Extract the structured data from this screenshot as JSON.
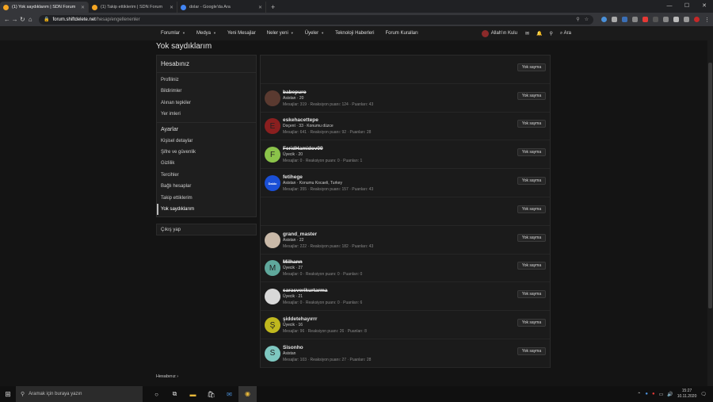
{
  "browser": {
    "tabs": [
      {
        "title": "(1) Yok saydıklarım | SDN Forum",
        "active": true,
        "icon_color": "#f5a623"
      },
      {
        "title": "(1) Takip ettiklerim | SDN Forum",
        "active": false,
        "icon_color": "#f5a623"
      },
      {
        "title": "dolar - Google'da Ara",
        "active": false,
        "icon_color": "#4285f4"
      }
    ],
    "url_host": "forum.shiftdelete.net",
    "url_path": "/hesap/engellenenler"
  },
  "sitenav": {
    "items": [
      "Forumlar",
      "Medya",
      "Yeni Mesajlar",
      "Neler yeni",
      "Üyeler",
      "Teknoloji Haberleri",
      "Forum Kuralları"
    ],
    "has_caret": [
      true,
      true,
      false,
      true,
      true,
      false,
      false
    ],
    "username": "Allah'ın Kulu",
    "search": "Ara"
  },
  "page": {
    "title": "Yok saydıklarım"
  },
  "sidebar": {
    "heading": "Hesabınız",
    "group1": [
      "Profiliniz",
      "Bildirimler",
      "Alınan tepkiler",
      "Yer imleri"
    ],
    "heading2": "Ayarlar",
    "group2": [
      "Kişisel detaylar",
      "Şifre ve güvenlik",
      "Gizlilik",
      "Tercihler",
      "Bağlı hesaplar",
      "Takip ettiklerim",
      "Yok saydıklarım"
    ],
    "logout": "Çıkış yap"
  },
  "ignore_label": "Yok sayma",
  "users": [
    {
      "name": "",
      "title": "",
      "stats": "",
      "avatar": "",
      "color": ""
    },
    {
      "name": "babepuro",
      "strike": true,
      "title": "Asistan · 20",
      "stats": "Mesajlar: 319 · Reaksiyon puanı: 124 · Puanları: 43",
      "avatar": "",
      "color": "#5a3a30"
    },
    {
      "name": "eskehacettepe",
      "strike": false,
      "title": "Doçent · 33 · Konumu düzce",
      "stats": "Mesajlar: 641 · Reaksiyon puanı: 92 · Puanları: 28",
      "avatar": "E",
      "color": "#8a1f1f"
    },
    {
      "name": "FeridHamidov09",
      "strike": true,
      "title": "Üyecik · 20",
      "stats": "Mesajlar: 0 · Reaksiyon puanı: 0 · Puanları: 1",
      "avatar": "F",
      "color": "#8bc34a"
    },
    {
      "name": "fetihege",
      "strike": false,
      "title": "Asistan · Konumu Kocaeli, Turkey",
      "stats": "Mesajlar: 355 · Reaksiyon puanı: 157 · Puanları: 43",
      "avatar": "Dakkı",
      "color": "#1a4fd6"
    },
    {
      "name": "",
      "title": "",
      "stats": "",
      "avatar": "",
      "color": ""
    },
    {
      "name": "grand_master",
      "strike": false,
      "title": "Asistan · 22",
      "stats": "Mesajlar: 222 · Reaksiyon puanı: 182 · Puanları: 43",
      "avatar": "",
      "color": "#c9b9a8"
    },
    {
      "name": "Milhann",
      "strike": true,
      "title": "Üyecik · 27",
      "stats": "Mesajlar: 0 · Reaksiyon puanı: 0 · Puanları: 0",
      "avatar": "M",
      "color": "#5fa89c"
    },
    {
      "name": "saracverikurtarma",
      "strike": true,
      "title": "Üyecik · 21",
      "stats": "Mesajlar: 0 · Reaksiyon puanı: 0 · Puanları: 6",
      "avatar": "",
      "color": "#d8d8d8"
    },
    {
      "name": "şiddetehayırrr",
      "strike": false,
      "title": "Üyecik · 16",
      "stats": "Mesajlar: 96 · Reaksiyon puanı: 26 · Puanları: 8",
      "avatar": "Ş",
      "color": "#c0b81e"
    },
    {
      "name": "Sisonho",
      "strike": false,
      "title": "Asistan",
      "stats": "Mesajlar: 103 · Reaksiyon puanı: 27 · Puanları: 28",
      "avatar": "S",
      "color": "#7ec7c0"
    }
  ],
  "breadcrumb": "Hesabınız",
  "taskbar": {
    "search_placeholder": "Aramak için buraya yazın",
    "time": "15:27",
    "date": "10.11.2020"
  }
}
